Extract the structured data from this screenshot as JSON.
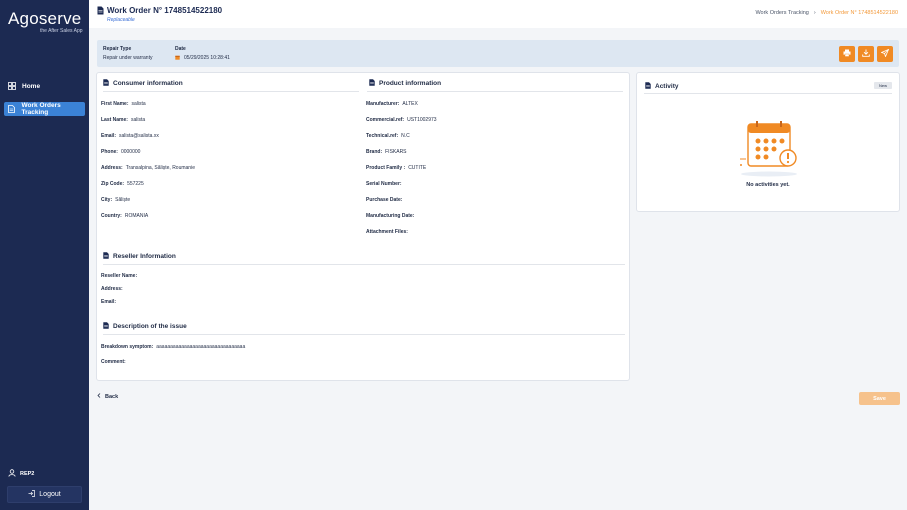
{
  "app": {
    "logo": "Agoserve",
    "tagline": "the After Sales App"
  },
  "sidebar": {
    "items": [
      {
        "label": "Home",
        "icon": "grid-icon"
      },
      {
        "label": "Work Orders Tracking",
        "icon": "document-icon"
      }
    ],
    "user": "REP2",
    "logout_label": "Logout"
  },
  "header": {
    "title": "Work Order N° 1748514522180",
    "subtitle": "Replaceable",
    "breadcrumb": [
      "Work Orders Tracking",
      "Work Order N° 1748514522180"
    ]
  },
  "repair": {
    "type_label": "Repair Type",
    "type_value": "Repair under warranty",
    "date_label": "Date",
    "date_value": "05/29/2025 10:28:41",
    "actions": [
      "print-icon",
      "download-icon",
      "send-icon"
    ]
  },
  "consumer": {
    "title": "Consumer information",
    "fields": [
      {
        "label": "First Name:",
        "value": "salista"
      },
      {
        "label": "Last Name:",
        "value": "salista"
      },
      {
        "label": "Email:",
        "value": "salista@salista.xx"
      },
      {
        "label": "Phone:",
        "value": "0000000"
      },
      {
        "label": "Address:",
        "value": "Transalpina, Săliște, Roumanie"
      },
      {
        "label": "Zip Code:",
        "value": "557225"
      },
      {
        "label": "City:",
        "value": "Săliște"
      },
      {
        "label": "Country:",
        "value": "ROMANIA"
      }
    ]
  },
  "product": {
    "title": "Product information",
    "fields": [
      {
        "label": "Manufacturer:",
        "value": "ALTEX"
      },
      {
        "label": "Commercial.ref:",
        "value": "UST1002973"
      },
      {
        "label": "Technical.ref:",
        "value": "N.C"
      },
      {
        "label": "Brand:",
        "value": "FISKARS"
      },
      {
        "label": "Product Family :",
        "value": "CUTITE"
      },
      {
        "label": "Serial Number:",
        "value": ""
      },
      {
        "label": "Purchase Date:",
        "value": ""
      },
      {
        "label": "Manufacturing Date:",
        "value": ""
      },
      {
        "label": "Attachment Files:",
        "value": ""
      }
    ]
  },
  "reseller": {
    "title": "Reseller Information",
    "fields": [
      {
        "label": "Reseller Name:",
        "value": ""
      },
      {
        "label": "Address:",
        "value": ""
      },
      {
        "label": "Email:",
        "value": ""
      }
    ]
  },
  "issue": {
    "title": "Description of the issue",
    "fields": [
      {
        "label": "Breakdown symptom:",
        "value": "aaaaaaaaaaaaaaaaaaaaaaaaaaaaaaaa"
      },
      {
        "label": "Comment:",
        "value": ""
      }
    ]
  },
  "activity": {
    "title": "Activity",
    "new_label": "New",
    "empty_text": "No activities yet."
  },
  "footer": {
    "back_label": "Back",
    "save_label": "Save"
  },
  "colors": {
    "sidebar": "#1c2a52",
    "accent": "#f08a24",
    "active_nav": "#3b82d6"
  }
}
